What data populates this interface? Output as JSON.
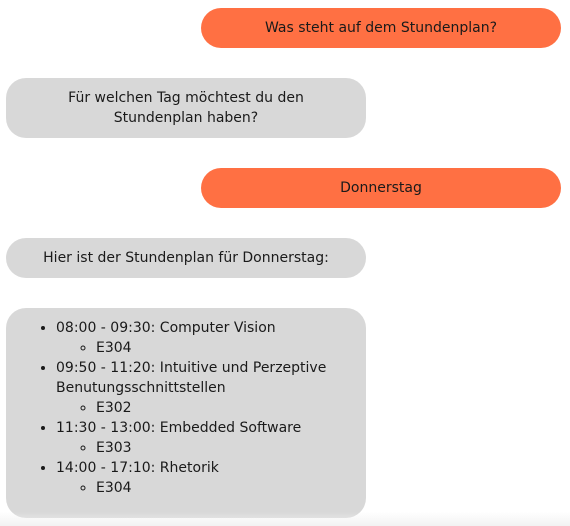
{
  "messages": [
    {
      "role": "user",
      "text": "Was steht auf dem Stundenplan?"
    },
    {
      "role": "bot",
      "text": "Für welchen Tag möchtest du den Stundenplan haben?"
    },
    {
      "role": "user",
      "text": "Donnerstag"
    },
    {
      "role": "bot",
      "text": "Hier ist der Stundenplan für Donnerstag:"
    }
  ],
  "schedule": [
    {
      "entry": "08:00 - 09:30: Computer Vision",
      "room": "E304"
    },
    {
      "entry": "09:50 - 11:20: Intuitive und Perzeptive Benutungsschnittstellen",
      "room": "E302"
    },
    {
      "entry": "11:30 - 13:00: Embedded Software",
      "room": "E303"
    },
    {
      "entry": "14:00 - 17:10: Rhetorik",
      "room": "E304"
    }
  ],
  "colors": {
    "user_bubble": "#ff7043",
    "bot_bubble": "#d8d8d8"
  }
}
